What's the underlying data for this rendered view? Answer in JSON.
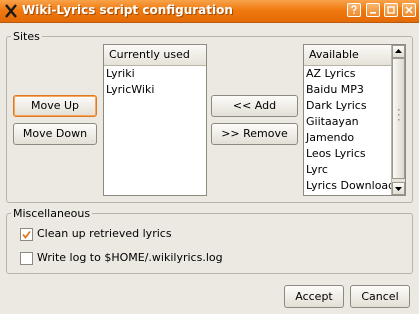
{
  "window": {
    "title": "Wiki-Lyrics script configuration",
    "icons": [
      "app-logo-icon",
      "help-icon",
      "minimize-icon",
      "maximize-icon",
      "close-icon"
    ],
    "accent_color": "#f07a10"
  },
  "sites": {
    "group_label": "Sites",
    "currently_used": {
      "header": "Currently used",
      "items": [
        "Lyriki",
        "LyricWiki"
      ]
    },
    "available": {
      "header": "Available",
      "items": [
        "AZ Lyrics",
        "Baidu MP3",
        "Dark Lyrics",
        "Giitaayan",
        "Jamendo",
        "Leos Lyrics",
        "Lyrc",
        "Lyrics Download"
      ]
    },
    "buttons": {
      "move_up": "Move Up",
      "move_down": "Move Down",
      "add": "<< Add",
      "remove": ">> Remove"
    }
  },
  "misc": {
    "group_label": "Miscellaneous",
    "cleanup": {
      "label": "Clean up retrieved lyrics",
      "checked": true
    },
    "writelog": {
      "label": "Write log to $HOME/.wikilyrics.log",
      "checked": false
    }
  },
  "dialog": {
    "accept": "Accept",
    "cancel": "Cancel"
  }
}
